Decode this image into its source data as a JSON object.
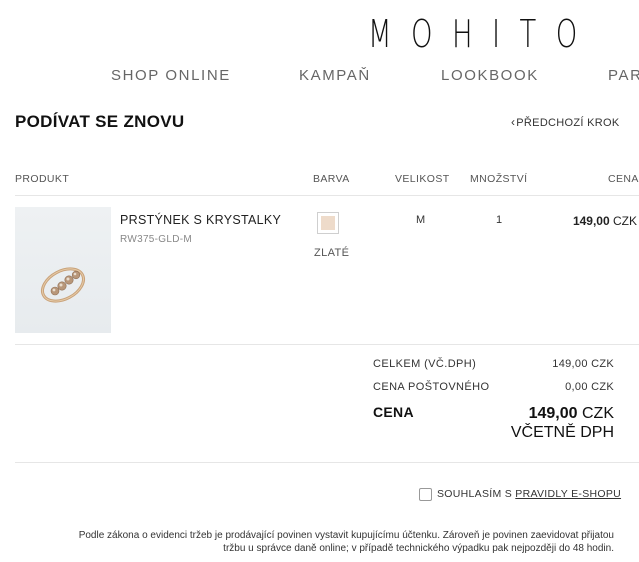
{
  "brand": {
    "logo": "MOHITO"
  },
  "nav": {
    "items": [
      {
        "label": "SHOP ONLINE"
      },
      {
        "label": "KAMPAŇ"
      },
      {
        "label": "LOOKBOOK"
      },
      {
        "label": "PAR"
      }
    ]
  },
  "page": {
    "title": "PODÍVAT SE ZNOVU",
    "back_label": "PŘEDCHOZÍ KROK"
  },
  "table": {
    "headers": {
      "product": "PRODUKT",
      "color": "BARVA",
      "size": "VELIKOST",
      "quantity": "MNOŽSTVÍ",
      "price": "CENA"
    },
    "items": [
      {
        "name": "PRSTÝNEK S KRYSTALKY",
        "sku": "RW375-GLD-M",
        "color_name": "ZLATÉ",
        "color_swatch": "#eedbca",
        "size": "M",
        "quantity": "1",
        "price_value": "149,00",
        "price_currency": "CZK"
      }
    ]
  },
  "summary": {
    "subtotal_label": "CELKEM (VČ.DPH)",
    "subtotal_value": "149,00 CZK",
    "shipping_label": "CENA POŠTOVNÉHO",
    "shipping_value": "0,00 CZK",
    "total_label": "CENA",
    "total_value": "149,00",
    "total_currency": "CZK",
    "total_note": "VČETNĚ DPH"
  },
  "consent": {
    "prefix": "SOUHLASÍM S ",
    "link": "PRAVIDLY E-SHOPU",
    "checked": false
  },
  "legal": {
    "line1": "Podle zákona o evidenci tržeb je prodávající povinen vystavit kupujícímu účtenku. Zároveň je povinen zaevidovat přijatou",
    "line2": "tržbu u správce daně online; v případě technického výpadku pak nejpozději do 48 hodin."
  }
}
